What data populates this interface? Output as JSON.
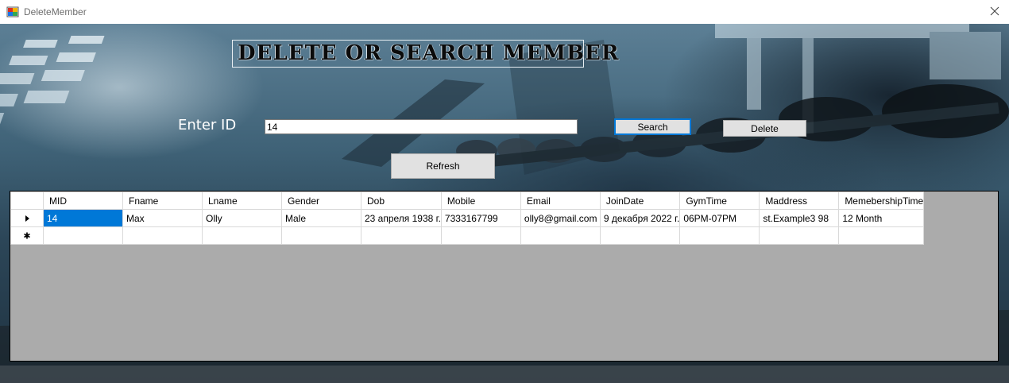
{
  "window": {
    "title": "DeleteMember",
    "colors": {
      "accent": "#0078d7",
      "grid_background": "#ababab"
    }
  },
  "heading": {
    "text": "DELETE OR SEARCH MEMBER"
  },
  "form": {
    "id_label": "Enter ID",
    "id_value": "14",
    "search_label": "Search",
    "delete_label": "Delete",
    "refresh_label": "Refresh"
  },
  "grid": {
    "columns": [
      "MID",
      "Fname",
      "Lname",
      "Gender",
      "Dob",
      "Mobile",
      "Email",
      "JoinDate",
      "GymTime",
      "Maddress",
      "MemebershipTime"
    ],
    "rows": [
      {
        "MID": "14",
        "Fname": "Max",
        "Lname": "Olly",
        "Gender": "Male",
        "Dob": "23 апреля 1938 г.",
        "Mobile": "7333167799",
        "Email": "olly8@gmail.com",
        "JoinDate": "9 декабря 2022 г.",
        "GymTime": "06PM-07PM",
        "Maddress": "st.Example3 98",
        "MemebershipTime": "12 Month"
      }
    ],
    "current_row_icon": "row-pointer-icon",
    "new_row_icon": "new-row-star-icon"
  }
}
